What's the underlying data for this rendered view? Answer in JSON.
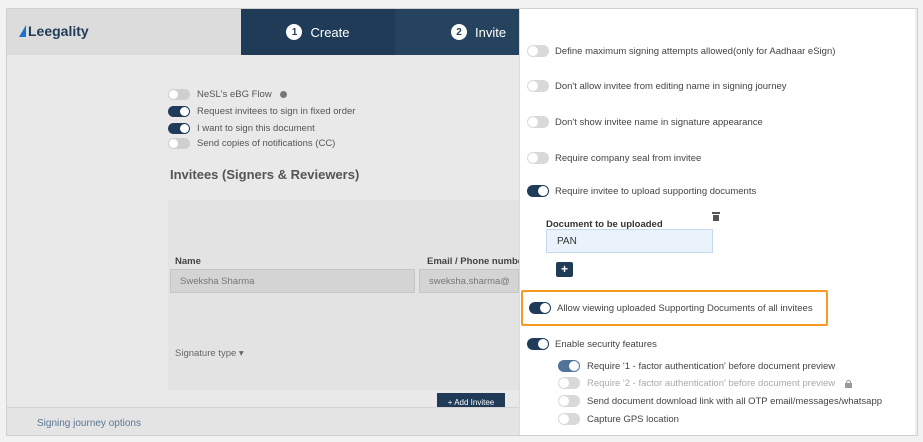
{
  "app": {
    "brand": "Leegality"
  },
  "steps": [
    {
      "num": "1",
      "label": "Create"
    },
    {
      "num": "2",
      "label": "Invite"
    }
  ],
  "left_options": {
    "nesl_ebg_flow": "NeSL's eBG Flow",
    "fixed_order": "Request invitees to sign in fixed order",
    "i_want_to_sign": "I want to sign this document",
    "send_copies": "Send copies of notifications (CC)"
  },
  "invitees": {
    "title": "Invitees (Signers & Reviewers)",
    "name_label": "Name",
    "name_value": "Sweksha Sharma",
    "email_label": "Email / Phone number",
    "email_value": "sweksha.sharma@",
    "signature_type": "Signature type ▾",
    "add_invitee": "+ Add Invitee"
  },
  "footer": {
    "signing_journey_options": "Signing journey options"
  },
  "drawer": {
    "define_max_attempts": "Define maximum signing attempts allowed(only for Aadhaar eSign)",
    "dont_allow_edit_name": "Don't allow invitee from editing name in signing journey",
    "dont_show_name": "Don't show invitee name in signature appearance",
    "require_company_seal": "Require company seal from invitee",
    "require_supporting_docs": "Require invitee to upload supporting documents",
    "doc_to_upload_label": "Document to be uploaded",
    "doc_value": "PAN",
    "add_doc_button": "+",
    "allow_viewing_docs": "Allow viewing uploaded Supporting Documents of all invitees",
    "enable_security": "Enable security features",
    "require_1fa": "Require '1 - factor authentication' before document preview",
    "require_2fa": "Require '2 - factor authentication' before document preview",
    "send_download_link": "Send document download link with all OTP email/messages/whatsapp",
    "capture_gps": "Capture GPS location"
  },
  "colors": {
    "primary": "#1f3b57",
    "highlight": "#f59a23",
    "logo_accent": "#1e70d0"
  }
}
